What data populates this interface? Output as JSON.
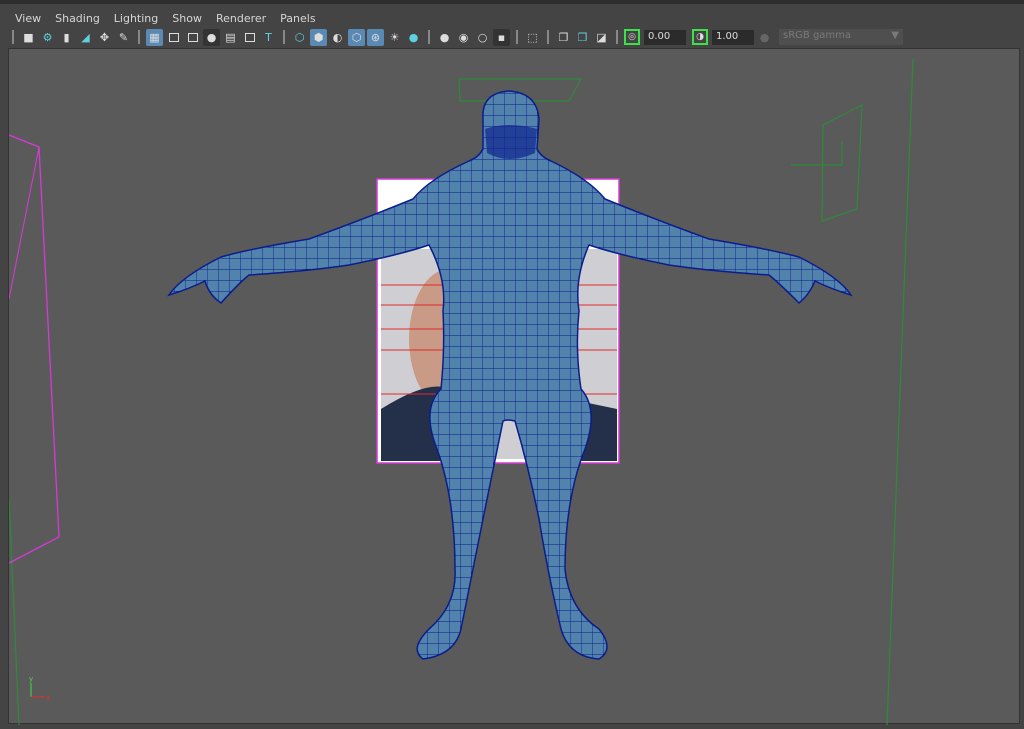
{
  "menus": [
    "View",
    "Shading",
    "Lighting",
    "Show",
    "Renderer",
    "Panels"
  ],
  "toolbar": {
    "exposure_value": "0.00",
    "gamma_value": "1.00",
    "color_space": "sRGB gamma",
    "icons": [
      "camera-icon",
      "camera-attributes-icon",
      "bookmark-icon",
      "image-plane-icon",
      "2d-pan-zoom-icon",
      "grease-pencil-icon",
      "grid-icon",
      "film-gate-icon",
      "resolution-gate-icon",
      "gate-mask-icon",
      "field-chart-icon",
      "safe-action-icon",
      "safe-title-icon",
      "wireframe-icon",
      "smooth-shade-icon",
      "default-material-icon",
      "wireframe-on-shaded-icon",
      "textured-icon",
      "use-all-lights-icon",
      "shadows-icon",
      "screen-space-ao-icon",
      "motion-blur-icon",
      "anti-aliasing-icon",
      "depth-of-field-icon",
      "isolate-select-icon",
      "xray-icon",
      "xray-active-icon",
      "xray-joints-icon"
    ]
  },
  "colors": {
    "mesh": "#4f7fa8",
    "wire": "#0b1d8c",
    "image_plane_border": "#d63ad6",
    "camera_lines": "#2f8a3a"
  }
}
